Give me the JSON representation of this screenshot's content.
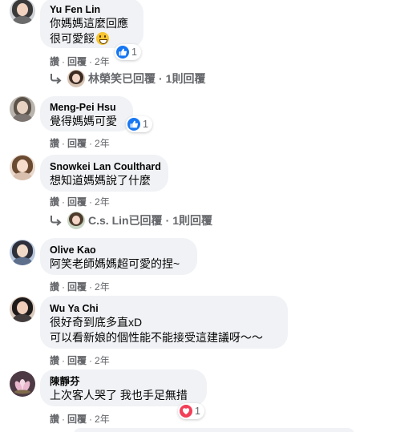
{
  "comments": [
    {
      "author": "Yu Fen Lin",
      "lines": [
        "你媽媽這麼回應",
        "很可愛餒"
      ],
      "trailing_emoji": "grinning-face-emoji",
      "reaction": {
        "type": "like",
        "count": "1"
      },
      "actions": {
        "like": "讚",
        "reply": "回覆",
        "time": "2年"
      },
      "replies": {
        "author": "林榮笑",
        "suffix": "已回覆",
        "count_text": "1則回覆"
      }
    },
    {
      "author": "Meng-Pei Hsu",
      "lines": [
        "覺得媽媽可愛"
      ],
      "reaction": {
        "type": "like",
        "count": "1"
      },
      "actions": {
        "like": "讚",
        "reply": "回覆",
        "time": "2年"
      }
    },
    {
      "author": "Snowkei Lan Coulthard",
      "lines": [
        "想知道媽媽說了什麼"
      ],
      "actions": {
        "like": "讚",
        "reply": "回覆",
        "time": "2年"
      },
      "replies": {
        "author": "C.s. Lin",
        "suffix": "已回覆",
        "count_text": "1則回覆"
      }
    },
    {
      "author": "Olive Kao",
      "lines": [
        "阿笑老師媽媽超可愛的捏~"
      ],
      "actions": {
        "like": "讚",
        "reply": "回覆",
        "time": "2年"
      }
    },
    {
      "author": "Wu Ya Chi",
      "lines": [
        "很好奇到底多直xD",
        "可以看新娘的個性能不能接受這建議呀～～"
      ],
      "actions": {
        "like": "讚",
        "reply": "回覆",
        "time": "2年"
      }
    },
    {
      "author": "陳靜芬",
      "lines": [
        "上次客人哭了 我也手足無措"
      ],
      "reaction": {
        "type": "love",
        "count": "1"
      },
      "actions": {
        "like": "讚",
        "reply": "回覆",
        "time": "2年"
      }
    }
  ],
  "separators": {
    "dot": "·"
  },
  "colors": {
    "bubble": "#f0f2f5",
    "meta": "#65676b",
    "like": "#1877f2",
    "love": "#f33e58"
  }
}
